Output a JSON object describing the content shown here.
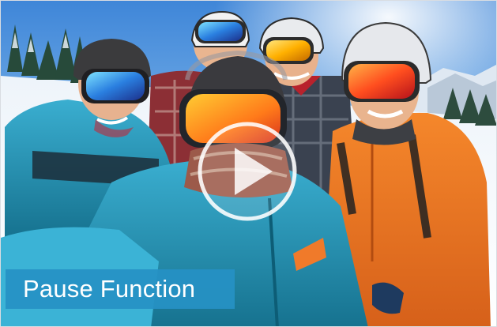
{
  "video": {
    "caption": "Pause Function",
    "play_icon": "play-icon",
    "colors": {
      "caption_bg": "#2691c4",
      "caption_text": "#ffffff",
      "play_overlay": "#ffffff"
    }
  }
}
